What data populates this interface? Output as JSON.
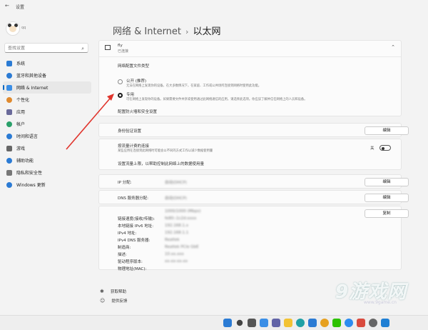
{
  "window": {
    "back_glyph": "←",
    "title": "设置"
  },
  "user": {
    "name": "qq"
  },
  "search": {
    "placeholder": "查找设置",
    "icon": "search-icon"
  },
  "sidebar": {
    "items": [
      {
        "label": "系统",
        "color": "#2b7bd4"
      },
      {
        "label": "蓝牙和其他设备",
        "color": "#2b7bd4"
      },
      {
        "label": "网络 & Internet",
        "color": "#3a8ee6",
        "selected": true
      },
      {
        "label": "个性化",
        "color": "#e08a2e"
      },
      {
        "label": "应用",
        "color": "#6a6a9a"
      },
      {
        "label": "帐户",
        "color": "#2aa06a"
      },
      {
        "label": "时间和语言",
        "color": "#2b7bd4"
      },
      {
        "label": "游戏",
        "color": "#666666"
      },
      {
        "label": "辅助功能",
        "color": "#2b7bd4"
      },
      {
        "label": "隐私和安全性",
        "color": "#777777"
      },
      {
        "label": "Windows 更新",
        "color": "#2b7bd4"
      }
    ]
  },
  "breadcrumb": {
    "parent": "网络 & Internet",
    "sep": "›",
    "current": "以太网"
  },
  "network": {
    "name": "fly",
    "status": "已连接",
    "expand_glyph": "⌃"
  },
  "profile": {
    "heading": "网络配置文件类型",
    "public_label": "公开 (推荐)",
    "public_desc": "无法在网络上发现你的设备。在大多数情况下，在家庭、工作或公共场所连接到网络时使用此功能。",
    "private_label": "专用",
    "private_desc": "可在网络上发现你的设备。如果需要文件共享或使用通过此网络通信的应用，请选择此选项。你应该了解并信任网络上的人员和设备。",
    "firewall_link": "配置防火墙和安全设置"
  },
  "auth": {
    "label": "身份验证设置",
    "button": "编辑"
  },
  "metered": {
    "label": "按流量计费的连接",
    "desc": "某些应用在连接到此网络时可能会以不同的方式工作以减少数据使用量",
    "toggle_label": "关",
    "on": false
  },
  "data_limit": {
    "link": "设置流量上限，以帮助控制此网络上的数据使用量"
  },
  "ip": {
    "label": "IP 分配:",
    "value": "自动(DHCP)",
    "button": "编辑"
  },
  "dns": {
    "label": "DNS 服务器分配:",
    "value": "自动(DHCP)",
    "button": "编辑"
  },
  "properties": {
    "rows": [
      {
        "label": "链接速度(接收/传输):",
        "value": "1000/1000 (Mbps)"
      },
      {
        "label": "本地链接 IPv6 地址:",
        "value": "fe80::1c2d:xxxx"
      },
      {
        "label": "IPv4 地址:",
        "value": "192.168.1.x"
      },
      {
        "label": "IPv4 DNS 服务器:",
        "value": "192.168.1.1"
      },
      {
        "label": "制造商:",
        "value": "Realtek"
      },
      {
        "label": "描述:",
        "value": "Realtek PCIe GbE"
      },
      {
        "label": "驱动程序版本:",
        "value": "10.xx.xxx"
      },
      {
        "label": "物理地址(MAC):",
        "value": "xx-xx-xx-xx"
      }
    ],
    "copy_button": "复制"
  },
  "footer": {
    "help": "获取帮助",
    "feedback": "提供反馈"
  },
  "watermark": {
    "text": "9游戏网",
    "sub": "www.9game.cn"
  },
  "taskbar": {
    "icons": [
      "start-icon",
      "search-icon",
      "taskview-icon",
      "widgets-icon",
      "chat-icon",
      "explorer-icon",
      "edge-icon",
      "store-icon",
      "chrome-icon",
      "wechat-icon",
      "qq-icon",
      "app-icon",
      "settings-icon",
      "app2-icon"
    ]
  }
}
